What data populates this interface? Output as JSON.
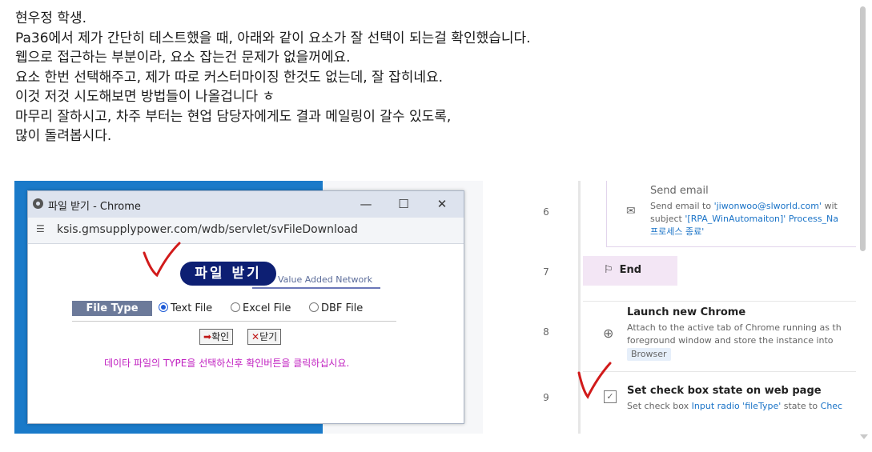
{
  "message": {
    "lines": [
      "현우정 학생.",
      "Pa36에서 제가 간단히 테스트했을 때, 아래와 같이 요소가 잘 선택이 되는걸 확인했습니다.",
      "웹으로 접근하는 부분이라, 요소 잡는건 문제가 없을꺼에요.",
      "요소 한번 선택해주고, 제가 따로 커스터마이징 한것도 없는데, 잘 잡히네요.",
      "이것 저것 시도해보면 방법들이 나올겁니다 ㅎ",
      "마무리 잘하시고, 차주 부터는 현업 담당자에게도 결과 메일링이 갈수 있도록,",
      "많이 돌려봅시다."
    ]
  },
  "left_screenshot": {
    "window_title": "파일 받기 - Chrome",
    "minimize_glyph": "—",
    "maximize_glyph": "☐",
    "close_glyph": "✕",
    "url": "ksis.gmsupplypower.com/wdb/servlet/svFileDownload",
    "logo_text": "파일 받기",
    "logo_subtitle": "Value Added Network",
    "file_type_label": "File Type",
    "options": [
      "Text File",
      "Excel File",
      "DBF File"
    ],
    "selected_option": "Text File",
    "confirm_button": "확인",
    "close_button": "닫기",
    "notice": "데이타 파일의 TYPE을 선택하신후 확인버튼을 클릭하십시요.",
    "annotation_color": "#d11a1a"
  },
  "right_screenshot": {
    "row_numbers": [
      "6",
      "7",
      "8",
      "9"
    ],
    "step6": {
      "title": "Send email",
      "desc_line1_prefix": "Send email to ",
      "desc_line1_email": "'jiwonwoo@slworld.com'",
      "desc_line1_suffix": " wit",
      "desc_line2_prefix": "subject ",
      "desc_line2_value": "'[RPA_WinAutomaiton]' Process_Na",
      "desc_line3": "프로세스 종료'"
    },
    "step7": {
      "title": "End"
    },
    "step8": {
      "title": "Launch new Chrome",
      "desc_line1": "Attach to the active tab of Chrome running as th",
      "desc_line2": "foreground window and store the instance into",
      "variable": "Browser"
    },
    "step9": {
      "title": "Set check box state on web page",
      "desc_prefix": "Set check box ",
      "desc_element": "Input radio 'fileType'",
      "desc_middle": " state to ",
      "desc_value": "Chec"
    }
  }
}
